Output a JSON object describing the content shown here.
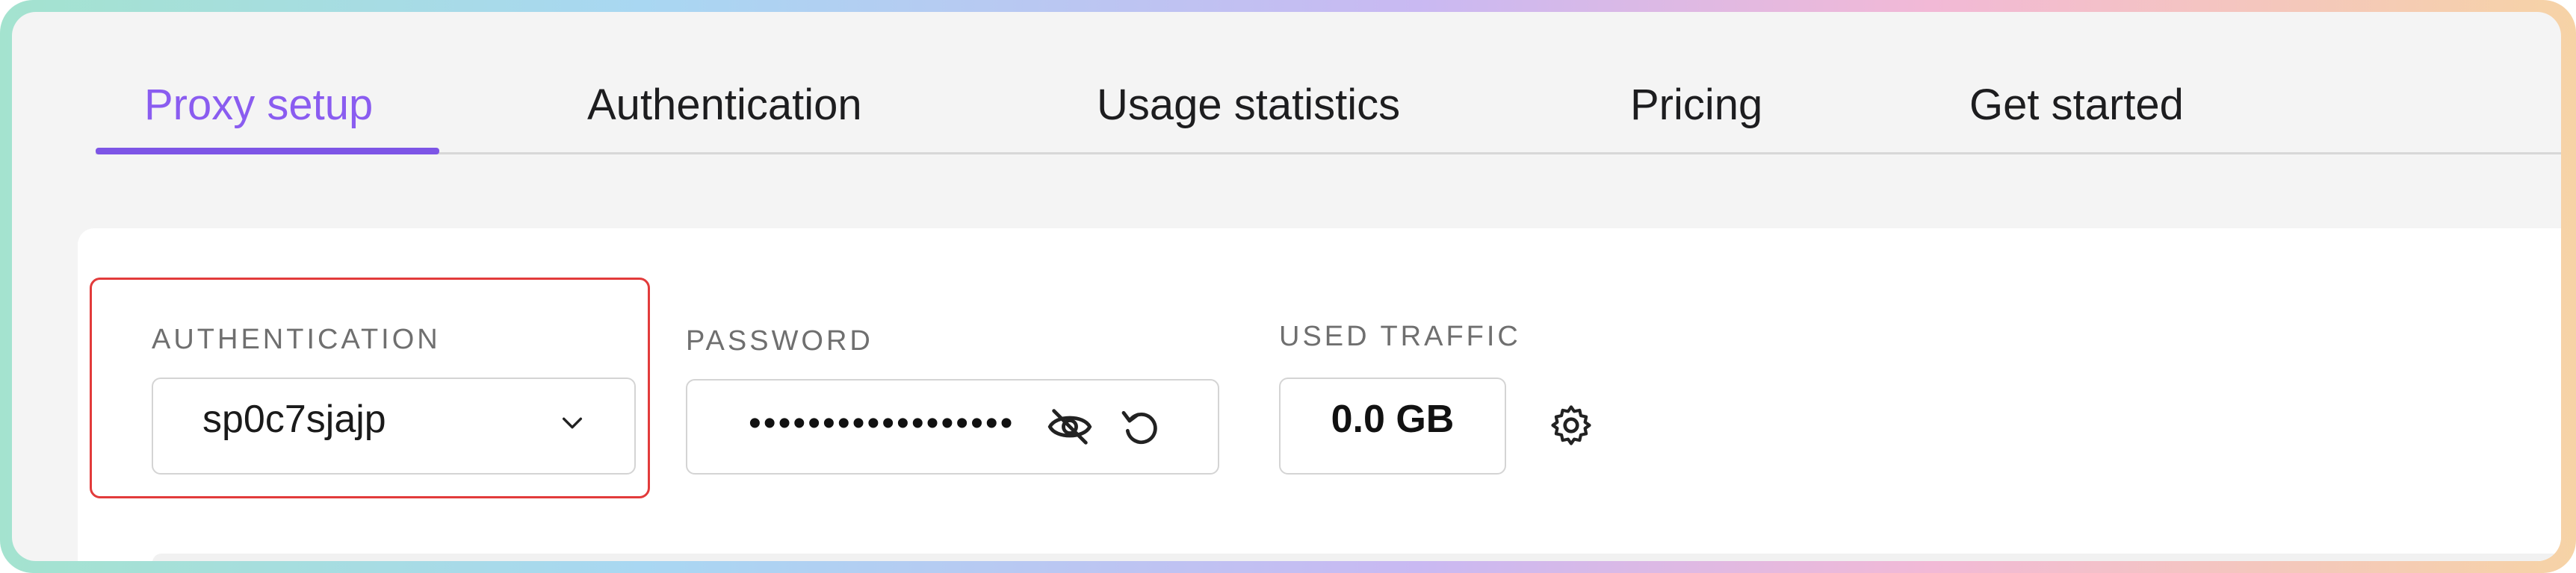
{
  "tabs": [
    {
      "label": "Proxy setup",
      "active": true
    },
    {
      "label": "Authentication",
      "active": false
    },
    {
      "label": "Usage statistics",
      "active": false
    },
    {
      "label": "Pricing",
      "active": false
    },
    {
      "label": "Get started",
      "active": false
    }
  ],
  "colors": {
    "accent": "#7d55e6",
    "highlight_border": "#e23b3b"
  },
  "auth": {
    "label": "AUTHENTICATION",
    "selected": "sp0c7sjajp",
    "icon": "chevron-down-icon"
  },
  "password": {
    "label": "PASSWORD",
    "masked_value": "••••••••••••••••••",
    "toggle_icon": "eye-off-icon",
    "reset_icon": "refresh-icon"
  },
  "traffic": {
    "label": "USED TRAFFIC",
    "value": "0.0 GB"
  },
  "settings": {
    "icon": "gear-icon"
  }
}
